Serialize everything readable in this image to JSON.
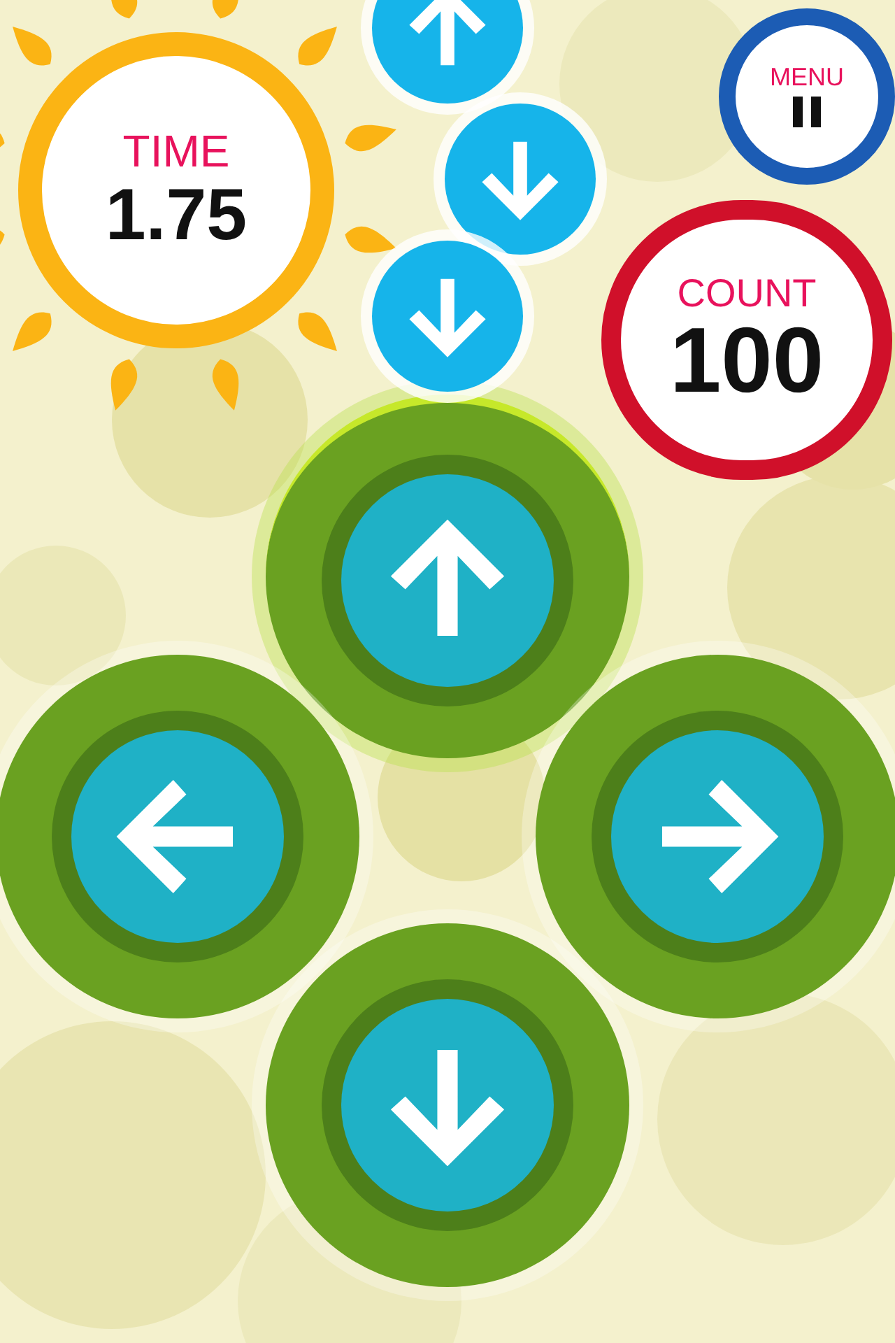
{
  "timer": {
    "label": "TIME",
    "value": "1.75"
  },
  "menu": {
    "label": "MENU"
  },
  "counter": {
    "label": "COUNT",
    "value": "100"
  },
  "falling_notes": [
    {
      "kind": "up"
    },
    {
      "kind": "down"
    },
    {
      "kind": "down"
    }
  ],
  "pads": [
    {
      "kind": "up",
      "lit": true
    },
    {
      "kind": "left",
      "lit": false
    },
    {
      "kind": "right",
      "lit": false
    },
    {
      "kind": "down",
      "lit": false
    }
  ]
}
